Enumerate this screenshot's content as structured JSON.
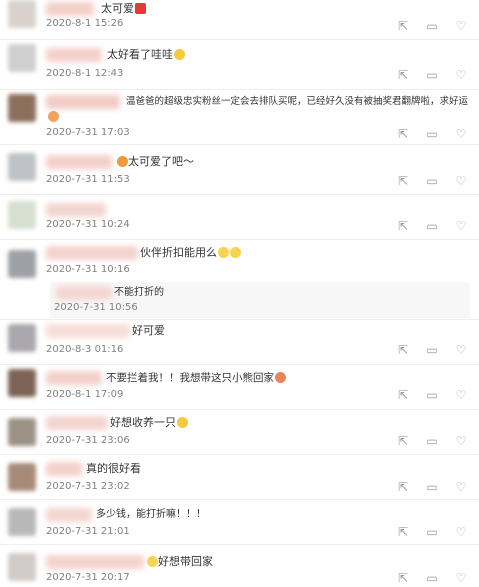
{
  "comments": [
    {
      "text": "太可爱",
      "emoji": "heart",
      "time": "2020-8-1 15:26"
    },
    {
      "text": "太好看了哇哇",
      "emoji": "cry",
      "time": "2020-8-1 12:43"
    },
    {
      "text": "温爸爸的超级忠实粉丝一定会去排队买呢，已经好久没有被抽奖君翻牌啦，求好运",
      "emoji": "face",
      "time": "2020-7-31 17:03"
    },
    {
      "text": "太可爱了吧～",
      "emoji": "",
      "time": "2020-7-31 11:53"
    },
    {
      "text": "",
      "emoji": "",
      "time": "2020-7-31 10:24"
    },
    {
      "text": "伙伴折扣能用么",
      "emoji": "smile",
      "time": "2020-7-31 10:16"
    },
    {
      "text": "不能打折的",
      "emoji": "",
      "time": "2020-7-31 10:56"
    },
    {
      "text": "好可爱",
      "emoji": "",
      "time": "2020-8-3 01:16"
    },
    {
      "text": "不要拦着我！！我想带这只小熊回家",
      "emoji": "face",
      "time": "2020-8-1 17:09"
    },
    {
      "text": "好想收养一只",
      "emoji": "cry",
      "time": "2020-7-31 23:06"
    },
    {
      "text": "真的很好看",
      "emoji": "",
      "time": "2020-7-31 23:02"
    },
    {
      "text": "多少钱，能打折嘛！！！",
      "emoji": "",
      "time": "2020-7-31 21:01"
    },
    {
      "text": "好想带回家",
      "emoji": "smile",
      "time": "2020-7-31 20:17"
    }
  ],
  "icons": {
    "share": "share-icon",
    "comment": "comment-icon",
    "like": "like-icon"
  }
}
